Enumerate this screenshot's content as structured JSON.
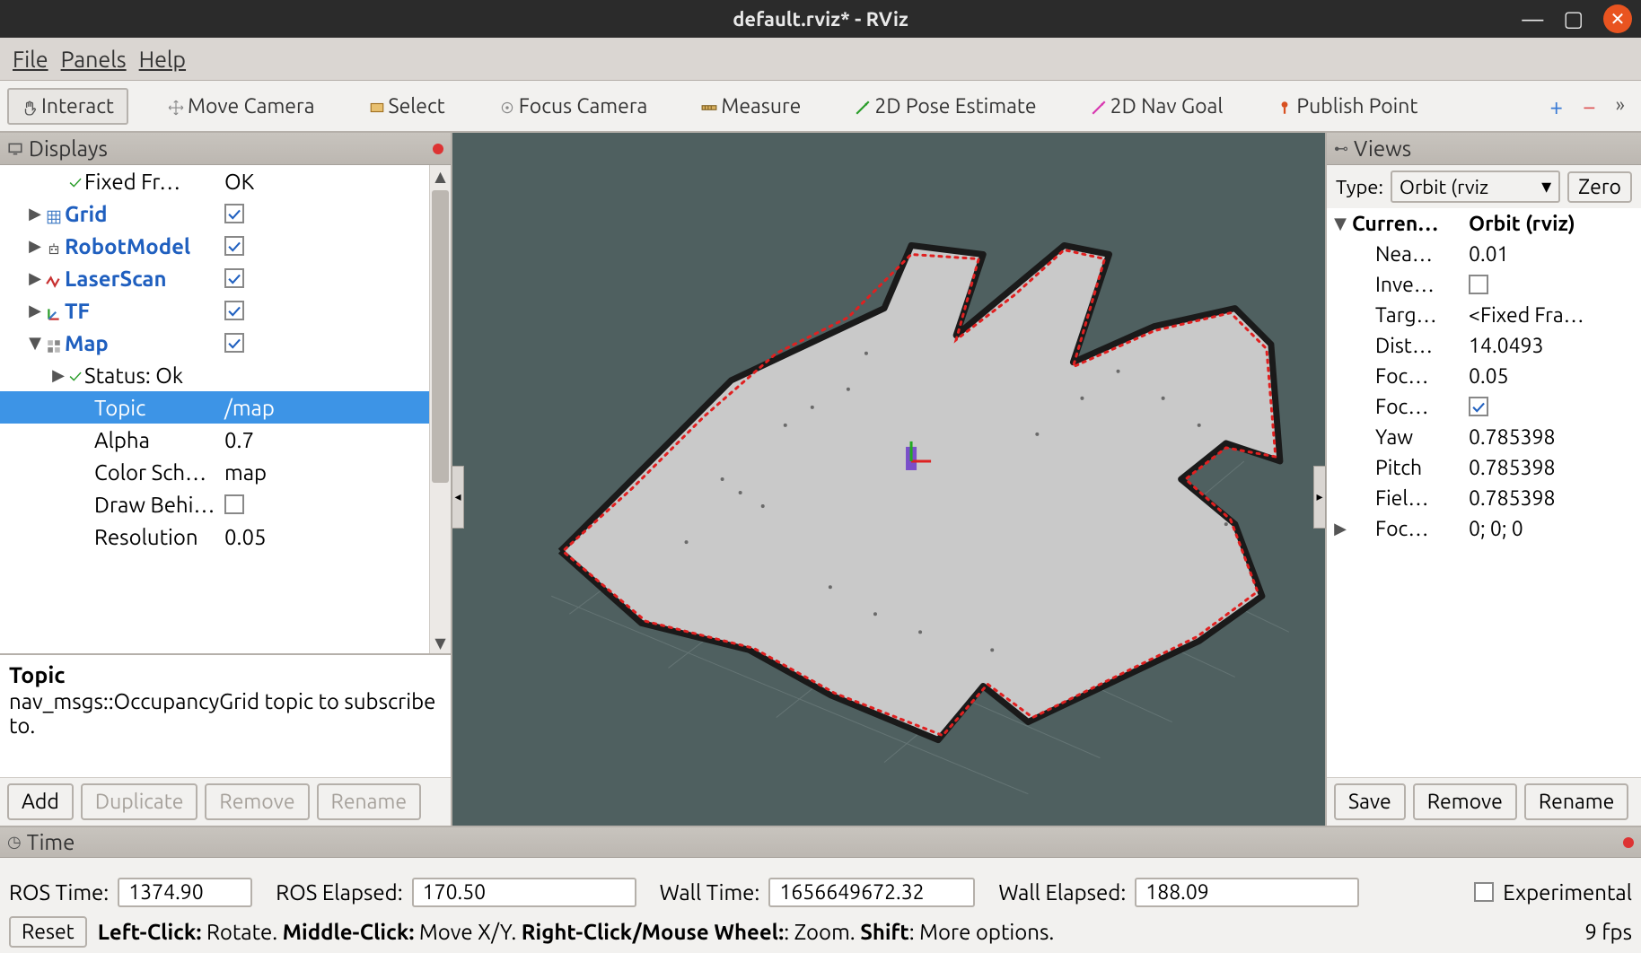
{
  "window": {
    "title": "default.rviz* - RViz"
  },
  "menubar": [
    "File",
    "Panels",
    "Help"
  ],
  "toolbar": [
    {
      "id": "interact",
      "label": "Interact",
      "icon": "hand",
      "active": true
    },
    {
      "id": "move-camera",
      "label": "Move Camera",
      "icon": "move",
      "active": false
    },
    {
      "id": "select",
      "label": "Select",
      "icon": "select",
      "active": false
    },
    {
      "id": "focus-camera",
      "label": "Focus Camera",
      "icon": "focus",
      "active": false
    },
    {
      "id": "measure",
      "label": "Measure",
      "icon": "measure",
      "active": false
    },
    {
      "id": "pose-estimate",
      "label": "2D Pose Estimate",
      "icon": "arrow-green",
      "active": false
    },
    {
      "id": "nav-goal",
      "label": "2D Nav Goal",
      "icon": "arrow-pink",
      "active": false
    },
    {
      "id": "publish-point",
      "label": "Publish Point",
      "icon": "pin",
      "active": false
    }
  ],
  "displays": {
    "title": "Displays",
    "tree": [
      {
        "level": 2,
        "expander": "",
        "check": true,
        "label": "Fixed Fr…",
        "value_text": "OK"
      },
      {
        "level": 1,
        "expander": "▶",
        "icon": "grid",
        "label": "Grid",
        "link": true,
        "value_cb": true
      },
      {
        "level": 1,
        "expander": "▶",
        "icon": "robot",
        "label": "RobotModel",
        "link": true,
        "value_cb": true
      },
      {
        "level": 1,
        "expander": "▶",
        "icon": "laser",
        "label": "LaserScan",
        "link": true,
        "value_cb": true
      },
      {
        "level": 1,
        "expander": "▶",
        "icon": "tf",
        "label": "TF",
        "link": true,
        "value_cb": true
      },
      {
        "level": 1,
        "expander": "▼",
        "icon": "map",
        "label": "Map",
        "link": true,
        "value_cb": true
      },
      {
        "level": 2,
        "expander": "▶",
        "check": true,
        "label": "Status: Ok"
      },
      {
        "level": 3,
        "label": "Topic",
        "value_text": "/map",
        "selected": true
      },
      {
        "level": 3,
        "label": "Alpha",
        "value_text": "0.7"
      },
      {
        "level": 3,
        "label": "Color Sch…",
        "value_text": "map"
      },
      {
        "level": 3,
        "label": "Draw Behi…",
        "value_cb": false
      },
      {
        "level": 3,
        "label": "Resolution",
        "value_text": "0.05"
      }
    ],
    "desc": {
      "title": "Topic",
      "body": "nav_msgs::OccupancyGrid topic to subscribe to."
    },
    "buttons": [
      {
        "id": "add",
        "label": "Add",
        "enabled": true
      },
      {
        "id": "duplicate",
        "label": "Duplicate",
        "enabled": false
      },
      {
        "id": "remove",
        "label": "Remove",
        "enabled": false
      },
      {
        "id": "rename",
        "label": "Rename",
        "enabled": false
      }
    ]
  },
  "views": {
    "title": "Views",
    "type_label": "Type:",
    "type_value": "Orbit (rviz",
    "zero_label": "Zero",
    "tree": [
      {
        "expander": "▼",
        "k": "Curren…",
        "v": "Orbit (rviz)",
        "bold": true
      },
      {
        "expander": "",
        "k": "Nea…",
        "v": "0.01"
      },
      {
        "expander": "",
        "k": "Inve…",
        "v_cb": false
      },
      {
        "expander": "",
        "k": "Targ…",
        "v": "<Fixed Fra…"
      },
      {
        "expander": "",
        "k": "Dist…",
        "v": "14.0493"
      },
      {
        "expander": "",
        "k": "Foc…",
        "v": "0.05"
      },
      {
        "expander": "",
        "k": "Foc…",
        "v_cb": true
      },
      {
        "expander": "",
        "k": "Yaw",
        "v": "0.785398"
      },
      {
        "expander": "",
        "k": "Pitch",
        "v": "0.785398"
      },
      {
        "expander": "",
        "k": "Fiel…",
        "v": "0.785398"
      },
      {
        "expander": "▶",
        "k": "Foc…",
        "v": "0; 0; 0"
      }
    ],
    "buttons": [
      {
        "id": "save",
        "label": "Save"
      },
      {
        "id": "remove",
        "label": "Remove"
      },
      {
        "id": "rename",
        "label": "Rename"
      }
    ]
  },
  "time": {
    "title": "Time",
    "ros_time_label": "ROS Time:",
    "ros_time": "1374.90",
    "ros_elapsed_label": "ROS Elapsed:",
    "ros_elapsed": "170.50",
    "wall_time_label": "Wall Time:",
    "wall_time": "1656649672.32",
    "wall_elapsed_label": "Wall Elapsed:",
    "wall_elapsed": "188.09",
    "experimental_label": "Experimental"
  },
  "status": {
    "reset_label": "Reset",
    "help_html": "<b>Left-Click:</b> Rotate. <b>Middle-Click:</b> Move X/Y. <b>Right-Click/Mouse Wheel:</b>: Zoom. <b>Shift</b>: More options.",
    "fps": "9 fps"
  },
  "colors": {
    "close_btn": "#e95420",
    "accent_blue": "#3d94e6",
    "link_blue": "#1f5fbf",
    "ok_green": "#2a9d2a",
    "laser_red": "#c83232",
    "view_bg": "#4f6060"
  }
}
